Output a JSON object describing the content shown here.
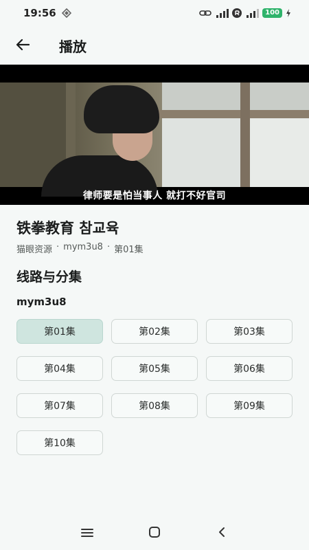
{
  "status_bar": {
    "time": "19:56",
    "battery": "100"
  },
  "app_bar": {
    "title": "播放"
  },
  "video": {
    "subtitle": "律师要是怕当事人 就打不好官司"
  },
  "show": {
    "title": "铁拳教育 참교육",
    "meta": [
      "猫眼资源",
      "·",
      "mym3u8",
      "·",
      "第01集"
    ]
  },
  "section": {
    "title": "线路与分集"
  },
  "source": {
    "name": "mym3u8"
  },
  "episodes": [
    {
      "label": "第01集",
      "selected": true
    },
    {
      "label": "第02集",
      "selected": false
    },
    {
      "label": "第03集",
      "selected": false
    },
    {
      "label": "第04集",
      "selected": false
    },
    {
      "label": "第05集",
      "selected": false
    },
    {
      "label": "第06集",
      "selected": false
    },
    {
      "label": "第07集",
      "selected": false
    },
    {
      "label": "第08集",
      "selected": false
    },
    {
      "label": "第09集",
      "selected": false
    },
    {
      "label": "第10集",
      "selected": false
    }
  ],
  "nav": {
    "icons": [
      "menu-icon",
      "home-icon",
      "back-icon"
    ]
  },
  "colors": {
    "background": "#f5f8f7",
    "selected_episode": "#cfe5df",
    "battery": "#2fb36b"
  }
}
